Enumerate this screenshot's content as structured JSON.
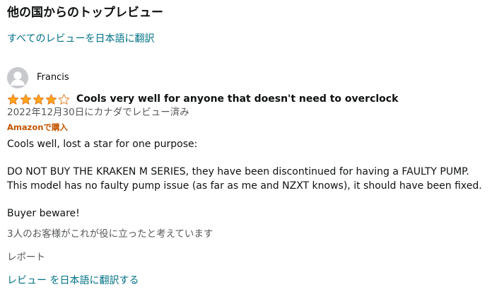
{
  "section": {
    "title": "他の国からのトップレビュー",
    "translate_all_link": "すべてのレビューを日本語に翻訳"
  },
  "review": {
    "author": "Francis",
    "avatar_icon": "default-user-avatar",
    "rating": 4,
    "rating_max": 5,
    "star_color": "#ffa41c",
    "title": "Cools very well for anyone that doesn't need to overclock",
    "date": "2022年12月30日にカナダでレビュー済み",
    "verified": "Amazonで購入",
    "body": {
      "line1": "Cools well, lost a star for one purpose:",
      "line2": "DO NOT BUY THE KRAKEN M SERIES, they have been discontinued for having a FAULTY PUMP.",
      "line3": "This model has no faulty pump issue (as far as me and NZXT knows), it should have been fixed.",
      "line4": "Buyer beware!"
    },
    "helpful": "3人のお客様がこれが役に立ったと考えています",
    "report": "レポート",
    "translate_link": "レビュー を日本語に翻訳する"
  },
  "colors": {
    "link": "#007185",
    "muted": "#565959",
    "verified": "#c45500",
    "text": "#0f1111"
  }
}
